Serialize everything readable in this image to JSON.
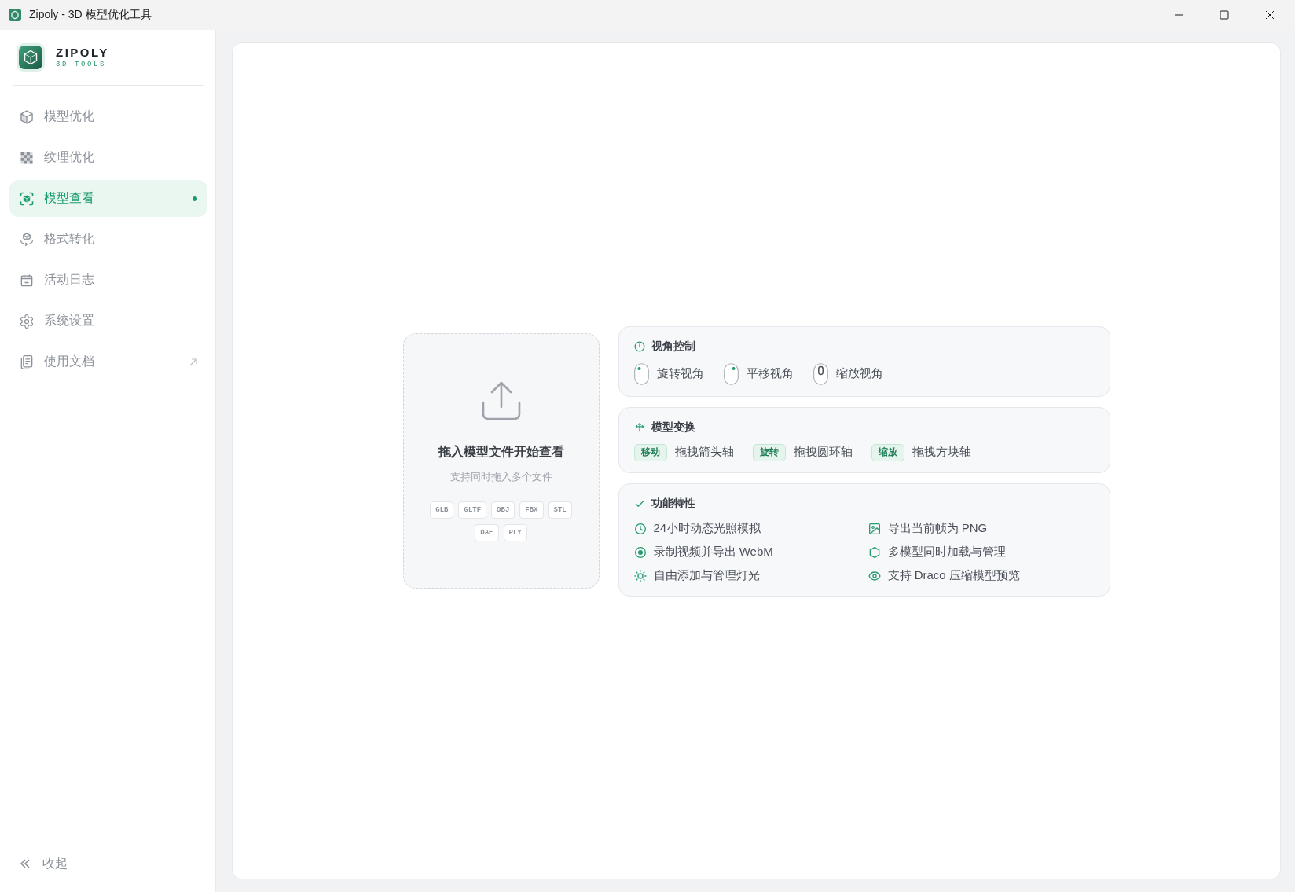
{
  "window": {
    "title": "Zipoly - 3D 模型优化工具"
  },
  "sidebar": {
    "brand": {
      "name": "ZIPOLY",
      "tagline": "3D TOOLS"
    },
    "items": [
      {
        "label": "模型优化",
        "selected": false,
        "external": false
      },
      {
        "label": "纹理优化",
        "selected": false,
        "external": false
      },
      {
        "label": "模型查看",
        "selected": true,
        "external": false
      },
      {
        "label": "格式转化",
        "selected": false,
        "external": false
      },
      {
        "label": "活动日志",
        "selected": false,
        "external": false
      },
      {
        "label": "系统设置",
        "selected": false,
        "external": false
      },
      {
        "label": "使用文档",
        "selected": false,
        "external": true
      }
    ],
    "collapse": {
      "label": "收起"
    }
  },
  "viewer": {
    "drop_zone": {
      "title": "拖入模型文件开始查看",
      "subtitle": "支持同时拖入多个文件",
      "formats": [
        "GLB",
        "GLTF",
        "OBJ",
        "FBX",
        "STL",
        "DAE",
        "PLY"
      ]
    },
    "view_controls": {
      "title": "视角控制",
      "items": [
        {
          "kind": "left",
          "label": "旋转视角"
        },
        {
          "kind": "right",
          "label": "平移视角"
        },
        {
          "kind": "wheel",
          "label": "缩放视角"
        }
      ]
    },
    "model_transform": {
      "title": "模型变换",
      "items": [
        {
          "tag": "移动",
          "label": "拖拽箭头轴"
        },
        {
          "tag": "旋转",
          "label": "拖拽圆环轴"
        },
        {
          "tag": "缩放",
          "label": "拖拽方块轴"
        }
      ]
    },
    "features": {
      "title": "功能特性",
      "items": [
        "24小时动态光照模拟",
        "导出当前帧为 PNG",
        "录制视频并导出 WebM",
        "多模型同时加载与管理",
        "自由添加与管理灯光",
        "支持 Draco 压缩模型预览"
      ]
    }
  }
}
